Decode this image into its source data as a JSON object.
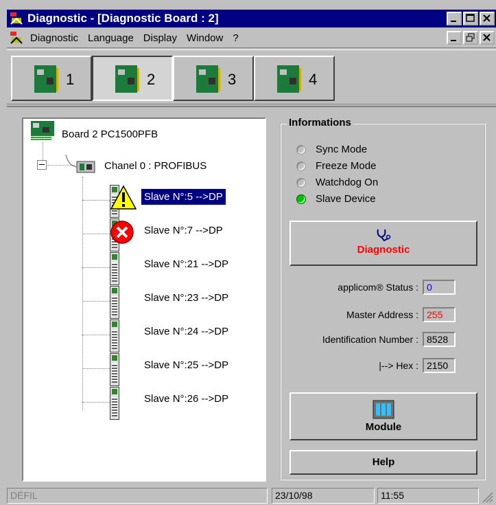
{
  "window": {
    "title": "Diagnostic - [Diagnostic Board : 2]"
  },
  "menu": {
    "items": [
      "Diagnostic",
      "Language",
      "Display",
      "Window",
      "?"
    ]
  },
  "boards": [
    {
      "label": "1",
      "active": false
    },
    {
      "label": "2",
      "active": true
    },
    {
      "label": "3",
      "active": false
    },
    {
      "label": "4",
      "active": false
    }
  ],
  "tree": {
    "board": "Board 2 PC1500PFB",
    "channel": "Chanel 0 : PROFIBUS",
    "slaves": [
      {
        "label": "Slave N°:5 -->DP",
        "status": "warning",
        "selected": true
      },
      {
        "label": "Slave N°:7 -->DP",
        "status": "error",
        "selected": false
      },
      {
        "label": "Slave N°:21 -->DP",
        "status": "ok",
        "selected": false
      },
      {
        "label": "Slave N°:23 -->DP",
        "status": "ok",
        "selected": false
      },
      {
        "label": "Slave N°:24 -->DP",
        "status": "ok",
        "selected": false
      },
      {
        "label": "Slave N°:25 -->DP",
        "status": "ok",
        "selected": false
      },
      {
        "label": "Slave N°:26 -->DP",
        "status": "ok",
        "selected": false
      }
    ]
  },
  "info": {
    "title": "Informations",
    "modes": [
      {
        "label": "Sync Mode",
        "on": false
      },
      {
        "label": "Freeze Mode",
        "on": false
      },
      {
        "label": "Watchdog On",
        "on": false
      },
      {
        "label": "Slave Device",
        "on": true
      }
    ],
    "diagnostic_button": "Diagnostic",
    "fields": [
      {
        "label": "applicom® Status :",
        "value": "0",
        "color": "#0000ff"
      },
      {
        "label": "Master Address :",
        "value": "255",
        "color": "#ff0000"
      },
      {
        "label": "Identification Number :",
        "value": "8528",
        "color": "#000000"
      },
      {
        "label": "|--> Hex :",
        "value": "2150",
        "color": "#000000"
      }
    ],
    "module_button": "Module",
    "help_button": "Help"
  },
  "status": {
    "left": "DÉFIL",
    "date": "23/10/98",
    "time": "11:55"
  }
}
